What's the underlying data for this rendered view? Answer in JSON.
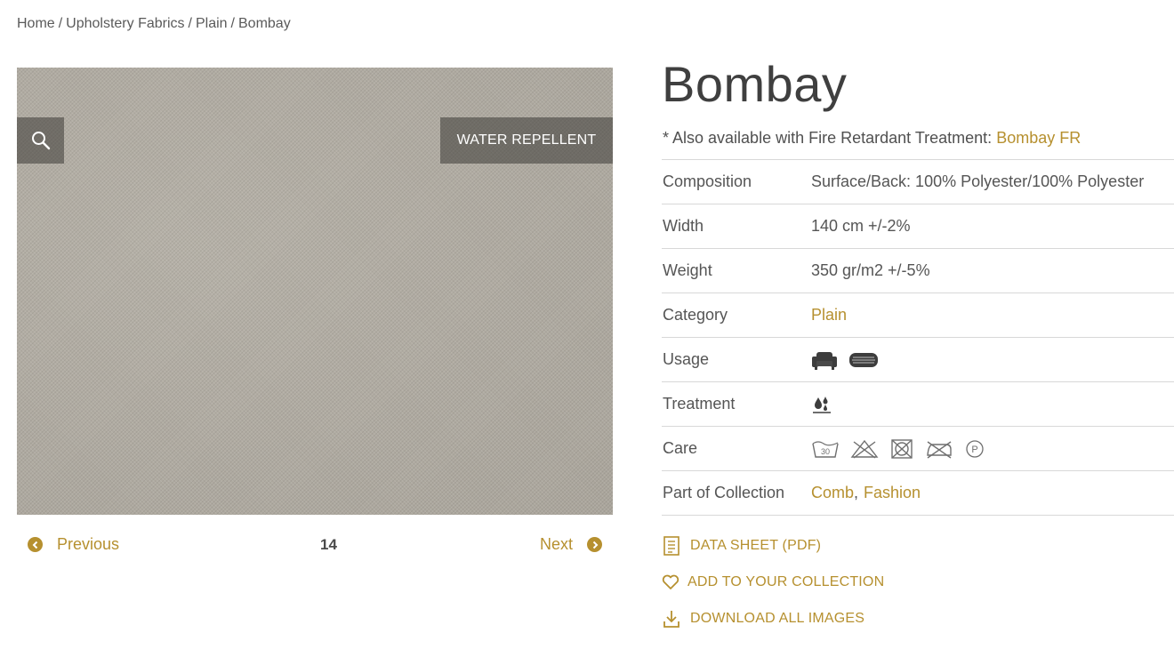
{
  "breadcrumb": {
    "items": [
      "Home",
      "Upholstery Fabrics",
      "Plain",
      "Bombay"
    ],
    "separator": "/"
  },
  "gallery": {
    "badge": "WATER REPELLENT",
    "zoom_icon": "search-icon"
  },
  "pager": {
    "previous": "Previous",
    "next": "Next",
    "number": "14"
  },
  "product": {
    "title": "Bombay",
    "fr_note_prefix": "* Also available with Fire Retardant Treatment: ",
    "fr_link": "Bombay FR"
  },
  "specs": {
    "composition": {
      "label": "Composition",
      "value": "Surface/Back: 100% Polyester/100% Polyester"
    },
    "width": {
      "label": "Width",
      "value": "140 cm +/-2%"
    },
    "weight": {
      "label": "Weight",
      "value": "350 gr/m2 +/-5%"
    },
    "category": {
      "label": "Category",
      "value": "Plain"
    },
    "usage": {
      "label": "Usage",
      "icons": [
        "armchair-icon",
        "cushion-icon"
      ]
    },
    "treatment": {
      "label": "Treatment",
      "icons": [
        "water-repellent-icon"
      ]
    },
    "care": {
      "label": "Care",
      "icons": [
        "wash-30-icon",
        "do-not-bleach-icon",
        "do-not-tumble-dry-icon",
        "do-not-iron-icon",
        "dry-clean-p-icon"
      ],
      "wash_temp": "30",
      "dry_clean_letter": "P"
    },
    "collection": {
      "label": "Part of Collection",
      "items": [
        "Comb",
        "Fashion"
      ],
      "separator": ","
    }
  },
  "actions": {
    "datasheet": "DATA SHEET (PDF)",
    "add_collection": "ADD TO YOUR COLLECTION",
    "download": "DOWNLOAD ALL IMAGES"
  },
  "colors": {
    "accent": "#b6902f",
    "text": "#4a4a4a",
    "fabric": "#b1aca2"
  }
}
